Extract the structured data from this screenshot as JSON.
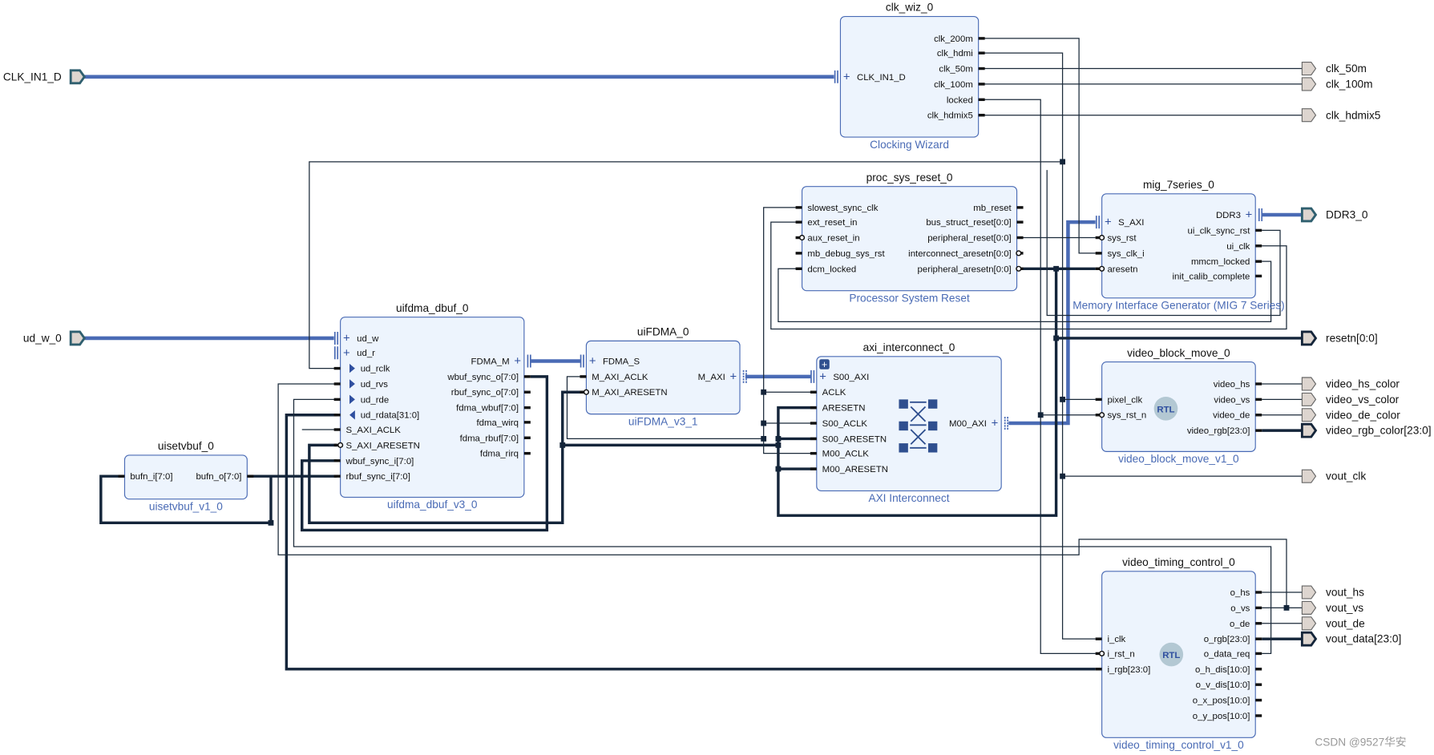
{
  "colors": {
    "block_fill": "#edf4fd",
    "block_border": "#4a6bb5",
    "wire": "#1b2a3a",
    "interface": "#4a6bb5",
    "port_fill": "#ddd5cf"
  },
  "blocks": [
    {
      "id": "clk_wiz_0",
      "type": "Clocking Wizard",
      "left": [
        {
          "n": "CLK_IN1_D",
          "k": "intf"
        }
      ],
      "right": [
        {
          "n": "clk_200m",
          "k": "s"
        },
        {
          "n": "clk_hdmi",
          "k": "s"
        },
        {
          "n": "clk_50m",
          "k": "s"
        },
        {
          "n": "clk_100m",
          "k": "s"
        },
        {
          "n": "locked",
          "k": "s"
        },
        {
          "n": "clk_hdmix5",
          "k": "s"
        }
      ]
    },
    {
      "id": "proc_sys_reset_0",
      "type": "Processor System Reset",
      "left": [
        {
          "n": "slowest_sync_clk",
          "k": "s"
        },
        {
          "n": "ext_reset_in",
          "k": "s"
        },
        {
          "n": "aux_reset_in",
          "k": "n"
        },
        {
          "n": "mb_debug_sys_rst",
          "k": "s"
        },
        {
          "n": "dcm_locked",
          "k": "s"
        }
      ],
      "right": [
        {
          "n": "mb_reset",
          "k": "s"
        },
        {
          "n": "bus_struct_reset[0:0]",
          "k": "s"
        },
        {
          "n": "peripheral_reset[0:0]",
          "k": "s"
        },
        {
          "n": "interconnect_aresetn[0:0]",
          "k": "n"
        },
        {
          "n": "peripheral_aresetn[0:0]",
          "k": "n"
        }
      ]
    },
    {
      "id": "mig_7series_0",
      "type": "Memory Interface Generator (MIG 7 Series)",
      "left": [
        {
          "n": "S_AXI",
          "k": "intf"
        },
        {
          "n": "sys_rst",
          "k": "n"
        },
        {
          "n": "sys_clk_i",
          "k": "s"
        },
        {
          "n": "aresetn",
          "k": "n"
        }
      ],
      "right": [
        {
          "n": "DDR3",
          "k": "intf"
        },
        {
          "n": "ui_clk_sync_rst",
          "k": "s"
        },
        {
          "n": "ui_clk",
          "k": "s"
        },
        {
          "n": "mmcm_locked",
          "k": "s"
        },
        {
          "n": "init_calib_complete",
          "k": "s"
        }
      ]
    },
    {
      "id": "uifdma_dbuf_0",
      "type": "uifdma_dbuf_v3_0",
      "left": [
        {
          "n": "ud_w",
          "k": "intf"
        },
        {
          "n": "ud_r",
          "k": "intf"
        },
        {
          "n": "ud_rclk",
          "k": "ar"
        },
        {
          "n": "ud_rvs",
          "k": "ar"
        },
        {
          "n": "ud_rde",
          "k": "ar"
        },
        {
          "n": "ud_rdata[31:0]",
          "k": "al"
        },
        {
          "n": "S_AXI_ACLK",
          "k": "s"
        },
        {
          "n": "S_AXI_ARESETN",
          "k": "n"
        },
        {
          "n": "wbuf_sync_i[7:0]",
          "k": "s"
        },
        {
          "n": "rbuf_sync_i[7:0]",
          "k": "s"
        }
      ],
      "right": [
        {
          "n": "FDMA_M",
          "k": "intf"
        },
        {
          "n": "wbuf_sync_o[7:0]",
          "k": "s"
        },
        {
          "n": "rbuf_sync_o[7:0]",
          "k": "s"
        },
        {
          "n": "fdma_wbuf[7:0]",
          "k": "s"
        },
        {
          "n": "fdma_wirq",
          "k": "s"
        },
        {
          "n": "fdma_rbuf[7:0]",
          "k": "s"
        },
        {
          "n": "fdma_rirq",
          "k": "s"
        }
      ]
    },
    {
      "id": "uiFDMA_0",
      "type": "uiFDMA_v3_1",
      "left": [
        {
          "n": "FDMA_S",
          "k": "intf"
        },
        {
          "n": "M_AXI_ACLK",
          "k": "s"
        },
        {
          "n": "M_AXI_ARESETN",
          "k": "n"
        }
      ],
      "right": [
        {
          "n": "M_AXI",
          "k": "intf"
        }
      ]
    },
    {
      "id": "axi_interconnect_0",
      "type": "AXI Interconnect",
      "left": [
        {
          "n": "S00_AXI",
          "k": "intf"
        },
        {
          "n": "ACLK",
          "k": "s"
        },
        {
          "n": "ARESETN",
          "k": "s"
        },
        {
          "n": "S00_ACLK",
          "k": "s"
        },
        {
          "n": "S00_ARESETN",
          "k": "s"
        },
        {
          "n": "M00_ACLK",
          "k": "s"
        },
        {
          "n": "M00_ARESETN",
          "k": "s"
        }
      ],
      "right": [
        {
          "n": "M00_AXI",
          "k": "intf"
        }
      ]
    },
    {
      "id": "uisetvbuf_0",
      "type": "uisetvbuf_v1_0",
      "left": [
        {
          "n": "bufn_i[7:0]",
          "k": "s"
        }
      ],
      "right": [
        {
          "n": "bufn_o[7:0]",
          "k": "s"
        }
      ]
    },
    {
      "id": "video_block_move_0",
      "type": "video_block_move_v1_0",
      "rtl": "RTL",
      "left": [
        {
          "n": "pixel_clk",
          "k": "s"
        },
        {
          "n": "sys_rst_n",
          "k": "n"
        }
      ],
      "right": [
        {
          "n": "video_hs",
          "k": "s"
        },
        {
          "n": "video_vs",
          "k": "s"
        },
        {
          "n": "video_de",
          "k": "s"
        },
        {
          "n": "video_rgb[23:0]",
          "k": "s"
        }
      ]
    },
    {
      "id": "video_timing_control_0",
      "type": "video_timing_control_v1_0",
      "rtl": "RTL",
      "left": [
        {
          "n": "i_clk",
          "k": "s"
        },
        {
          "n": "i_rst_n",
          "k": "n"
        },
        {
          "n": "i_rgb[23:0]",
          "k": "s"
        }
      ],
      "right": [
        {
          "n": "o_hs",
          "k": "s"
        },
        {
          "n": "o_vs",
          "k": "s"
        },
        {
          "n": "o_de",
          "k": "s"
        },
        {
          "n": "o_rgb[23:0]",
          "k": "s"
        },
        {
          "n": "o_data_req",
          "k": "s"
        },
        {
          "n": "o_h_dis[10:0]",
          "k": "s"
        },
        {
          "n": "o_v_dis[10:0]",
          "k": "s"
        },
        {
          "n": "o_x_pos[10:0]",
          "k": "s"
        },
        {
          "n": "o_y_pos[10:0]",
          "k": "s"
        }
      ]
    }
  ],
  "external_ports": [
    {
      "n": "CLK_IN1_D",
      "dir": "in",
      "intf": true
    },
    {
      "n": "ud_w_0",
      "dir": "in",
      "intf": true
    },
    {
      "n": "clk_50m",
      "dir": "out"
    },
    {
      "n": "clk_100m",
      "dir": "out"
    },
    {
      "n": "clk_hdmix5",
      "dir": "out"
    },
    {
      "n": "DDR3_0",
      "dir": "out",
      "intf": true
    },
    {
      "n": "resetn[0:0]",
      "dir": "out",
      "bus": true
    },
    {
      "n": "video_hs_color",
      "dir": "out"
    },
    {
      "n": "video_vs_color",
      "dir": "out"
    },
    {
      "n": "video_de_color",
      "dir": "out"
    },
    {
      "n": "video_rgb_color[23:0]",
      "dir": "out",
      "bus": true
    },
    {
      "n": "vout_clk",
      "dir": "out"
    },
    {
      "n": "vout_hs",
      "dir": "out"
    },
    {
      "n": "vout_vs",
      "dir": "out"
    },
    {
      "n": "vout_de",
      "dir": "out"
    },
    {
      "n": "vout_data[23:0]",
      "dir": "out",
      "bus": true
    }
  ],
  "watermark": "CSDN @9527华安"
}
